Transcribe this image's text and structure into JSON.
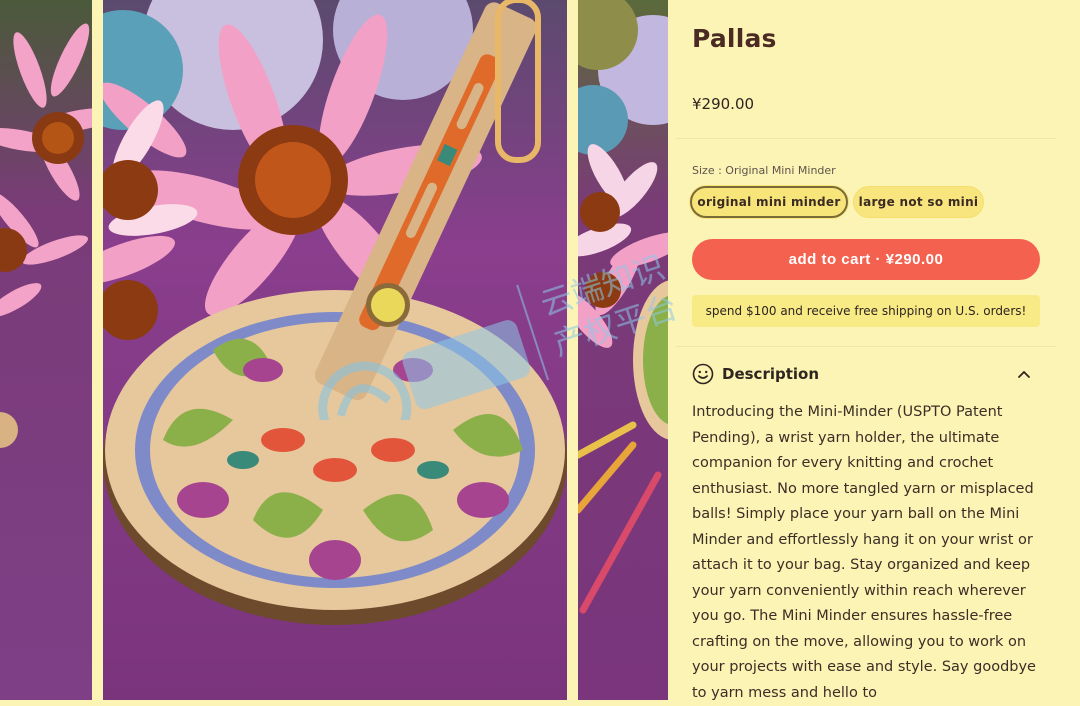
{
  "product": {
    "title": "Pallas",
    "price": "¥290.00"
  },
  "size_selector": {
    "label": "Size : Original Mini Minder",
    "options": [
      {
        "label": "original mini minder",
        "selected": true
      },
      {
        "label": "large not so mini",
        "selected": false
      }
    ]
  },
  "cart": {
    "button_label": "add to cart · ¥290.00"
  },
  "promo": {
    "text": "spend $100 and receive free shipping on U.S. orders!"
  },
  "description": {
    "heading": "Description",
    "heading_icon": "smile-icon",
    "toggle_icon": "chevron-up-icon",
    "body": "Introducing the Mini-Minder (USPTO Patent Pending), a wrist yarn holder, the ultimate companion for every knitting and crochet enthusiast. No more tangled yarn or misplaced balls! Simply place your yarn ball on the Mini Minder and effortlessly hang it on your wrist or attach it to your bag. Stay organized and keep your yarn conveniently within reach wherever you go. The Mini Minder ensures hassle-free crafting on the move, allowing you to work on your projects with ease and style. Say goodbye to yarn mess and hello to"
  },
  "watermark": {
    "text_line1": "云端知识",
    "text_line2": "产权平台"
  },
  "colors": {
    "background": "#fbf4b4",
    "accent": "#f4614f",
    "variant_fill": "#f7e57a",
    "promo_fill": "#f8eb86",
    "title_color": "#4a2a22"
  }
}
